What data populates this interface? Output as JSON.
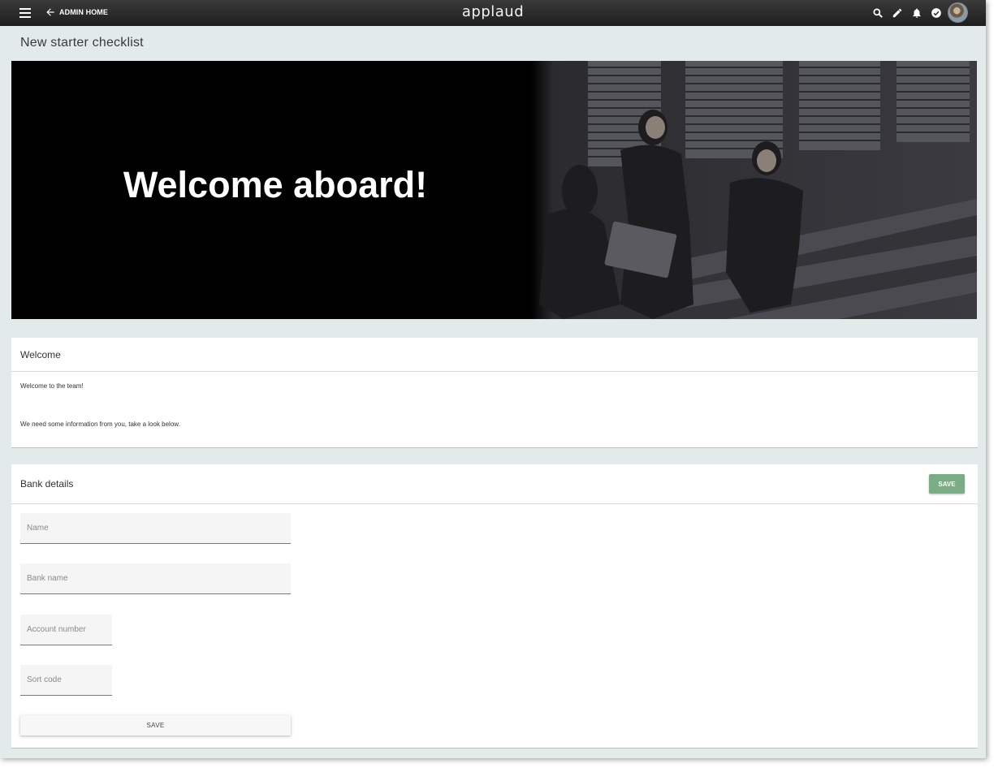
{
  "header": {
    "back_label": "ADMIN HOME",
    "logo": "applaud",
    "icons": [
      "menu-icon",
      "arrow-left-icon",
      "search-icon",
      "pencil-icon",
      "bell-icon",
      "check-circle-icon",
      "avatar"
    ]
  },
  "page": {
    "title": "New starter checklist"
  },
  "banner": {
    "text": "Welcome aboard!"
  },
  "welcome_card": {
    "title": "Welcome",
    "line1": "Welcome to the team!",
    "line2": "We need some information from you, take a look below."
  },
  "bank_card": {
    "title": "Bank details",
    "save_top_label": "SAVE",
    "fields": {
      "name": "Name",
      "bank_name": "Bank name",
      "account_number": "Account number",
      "sort_code": "Sort code"
    },
    "save_bottom_label": "SAVE"
  },
  "colors": {
    "topbar": "#1e1e1e",
    "page_background": "#e2ebea",
    "save_accent": "#7aad84"
  }
}
